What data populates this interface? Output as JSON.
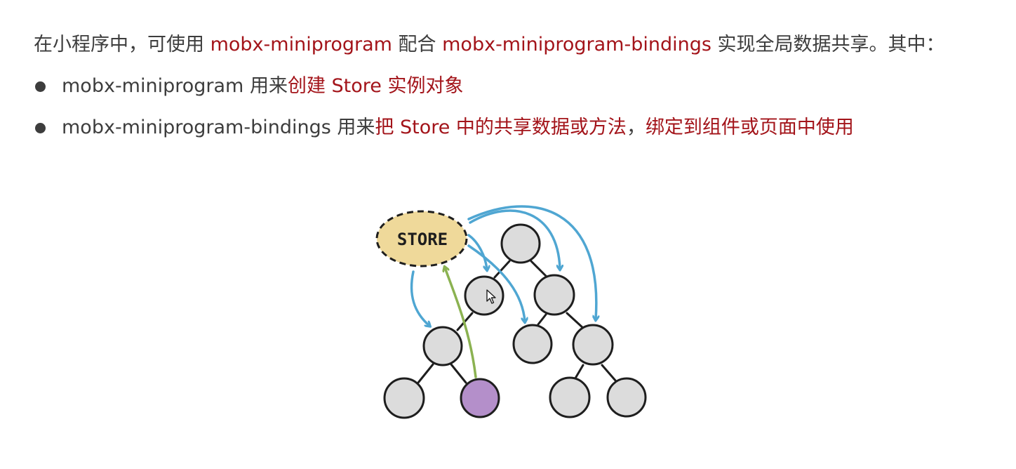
{
  "intro": {
    "t1": "在小程序中，可使用 ",
    "pkg1": "mobx-miniprogram",
    "t2": " 配合 ",
    "pkg2": "mobx-miniprogram-bindings",
    "t3": " 实现全局数据共享。其中："
  },
  "bullets": [
    {
      "name": "mobx-miniprogram",
      "verb": " 用来",
      "desc": "创建 Store 实例对象"
    },
    {
      "name": "mobx-miniprogram-bindings",
      "verb": " 用来",
      "desc": "把 Store 中的共享数据或方法",
      "sep": "，",
      "desc2": "绑定到组件或页面中使用"
    }
  ],
  "diagram": {
    "store_label": "STORE",
    "colors": {
      "store_fill": "#efd99a",
      "node_fill": "#dcdcdc",
      "highlight_node": "#b48fca",
      "blue_arrow": "#4fa6d2",
      "green_arrow": "#8bb251",
      "edge": "#1e1e1e"
    }
  }
}
